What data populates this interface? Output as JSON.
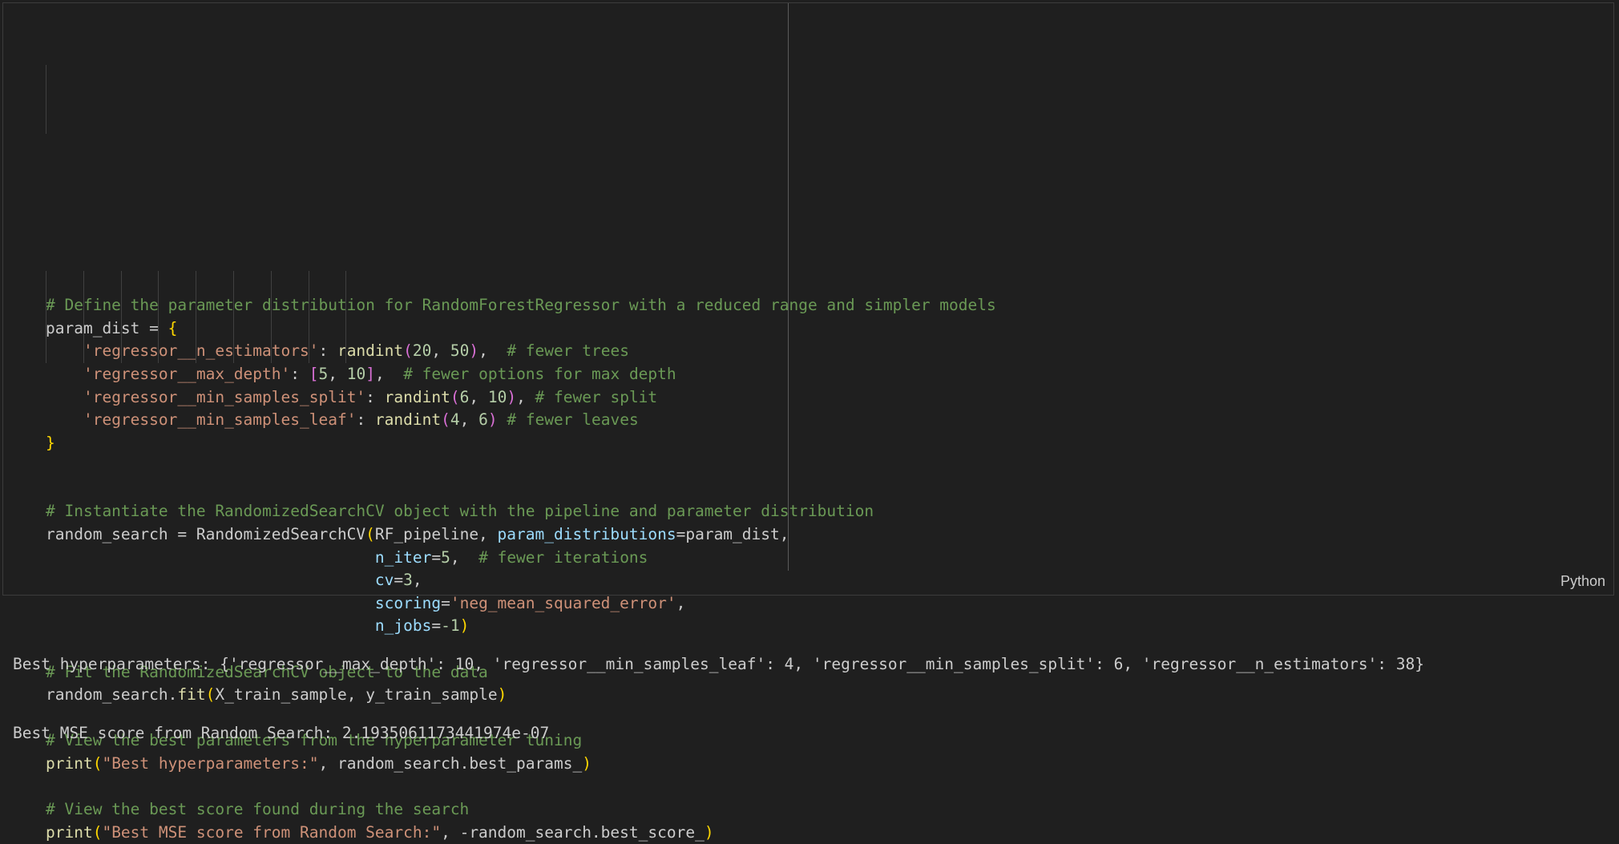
{
  "cell": {
    "language": "Python",
    "lines": [
      {
        "tokens": [
          {
            "t": "# Define the parameter distribution for RandomForestRegressor with a reduced range and simpler models",
            "c": "cmt"
          }
        ]
      },
      {
        "tokens": [
          {
            "t": "param_dist = ",
            "c": ""
          },
          {
            "t": "{",
            "c": "b1"
          }
        ]
      },
      {
        "tokens": [
          {
            "t": "    ",
            "c": ""
          },
          {
            "t": "'regressor__n_estimators'",
            "c": "str"
          },
          {
            "t": ": ",
            "c": ""
          },
          {
            "t": "randint",
            "c": "fn"
          },
          {
            "t": "(",
            "c": "b2"
          },
          {
            "t": "20",
            "c": "num"
          },
          {
            "t": ", ",
            "c": ""
          },
          {
            "t": "50",
            "c": "num"
          },
          {
            "t": ")",
            "c": "b2"
          },
          {
            "t": ",  ",
            "c": ""
          },
          {
            "t": "# fewer trees",
            "c": "cmt"
          }
        ]
      },
      {
        "tokens": [
          {
            "t": "    ",
            "c": ""
          },
          {
            "t": "'regressor__max_depth'",
            "c": "str"
          },
          {
            "t": ": ",
            "c": ""
          },
          {
            "t": "[",
            "c": "b2"
          },
          {
            "t": "5",
            "c": "num"
          },
          {
            "t": ", ",
            "c": ""
          },
          {
            "t": "10",
            "c": "num"
          },
          {
            "t": "]",
            "c": "b2"
          },
          {
            "t": ",  ",
            "c": ""
          },
          {
            "t": "# fewer options for max depth",
            "c": "cmt"
          }
        ]
      },
      {
        "tokens": [
          {
            "t": "    ",
            "c": ""
          },
          {
            "t": "'regressor__min_samples_split'",
            "c": "str"
          },
          {
            "t": ": ",
            "c": ""
          },
          {
            "t": "randint",
            "c": "fn"
          },
          {
            "t": "(",
            "c": "b2"
          },
          {
            "t": "6",
            "c": "num"
          },
          {
            "t": ", ",
            "c": ""
          },
          {
            "t": "10",
            "c": "num"
          },
          {
            "t": ")",
            "c": "b2"
          },
          {
            "t": ", ",
            "c": ""
          },
          {
            "t": "# fewer split",
            "c": "cmt"
          }
        ]
      },
      {
        "tokens": [
          {
            "t": "    ",
            "c": ""
          },
          {
            "t": "'regressor__min_samples_leaf'",
            "c": "str"
          },
          {
            "t": ": ",
            "c": ""
          },
          {
            "t": "randint",
            "c": "fn"
          },
          {
            "t": "(",
            "c": "b2"
          },
          {
            "t": "4",
            "c": "num"
          },
          {
            "t": ", ",
            "c": ""
          },
          {
            "t": "6",
            "c": "num"
          },
          {
            "t": ")",
            "c": "b2"
          },
          {
            "t": " ",
            "c": ""
          },
          {
            "t": "# fewer leaves",
            "c": "cmt"
          }
        ]
      },
      {
        "tokens": [
          {
            "t": "}",
            "c": "b1"
          }
        ]
      },
      {
        "tokens": []
      },
      {
        "tokens": []
      },
      {
        "tokens": [
          {
            "t": "# Instantiate the RandomizedSearchCV object with the pipeline and parameter distribution",
            "c": "cmt"
          }
        ]
      },
      {
        "tokens": [
          {
            "t": "random_search = ",
            "c": ""
          },
          {
            "t": "RandomizedSearchCV",
            "c": ""
          },
          {
            "t": "(",
            "c": "b1"
          },
          {
            "t": "RF_pipeline, ",
            "c": ""
          },
          {
            "t": "param_distributions",
            "c": "param"
          },
          {
            "t": "=param_dist,",
            "c": ""
          }
        ]
      },
      {
        "tokens": [
          {
            "t": "                                   ",
            "c": ""
          },
          {
            "t": "n_iter",
            "c": "param"
          },
          {
            "t": "=",
            "c": ""
          },
          {
            "t": "5",
            "c": "num"
          },
          {
            "t": ",  ",
            "c": ""
          },
          {
            "t": "# fewer iterations",
            "c": "cmt"
          }
        ]
      },
      {
        "tokens": [
          {
            "t": "                                   ",
            "c": ""
          },
          {
            "t": "cv",
            "c": "param"
          },
          {
            "t": "=",
            "c": ""
          },
          {
            "t": "3",
            "c": "num"
          },
          {
            "t": ",",
            "c": ""
          }
        ]
      },
      {
        "tokens": [
          {
            "t": "                                   ",
            "c": ""
          },
          {
            "t": "scoring",
            "c": "param"
          },
          {
            "t": "=",
            "c": ""
          },
          {
            "t": "'neg_mean_squared_error'",
            "c": "str"
          },
          {
            "t": ",",
            "c": ""
          }
        ]
      },
      {
        "tokens": [
          {
            "t": "                                   ",
            "c": ""
          },
          {
            "t": "n_jobs",
            "c": "param"
          },
          {
            "t": "=",
            "c": ""
          },
          {
            "t": "-1",
            "c": "num"
          },
          {
            "t": ")",
            "c": "b1"
          }
        ]
      },
      {
        "tokens": []
      },
      {
        "tokens": [
          {
            "t": "# Fit the RandomizedSearchCV object to the data",
            "c": "cmt"
          }
        ]
      },
      {
        "tokens": [
          {
            "t": "random_search.",
            "c": ""
          },
          {
            "t": "fit",
            "c": "fn"
          },
          {
            "t": "(",
            "c": "b1"
          },
          {
            "t": "X_train_sample, y_train_sample",
            "c": ""
          },
          {
            "t": ")",
            "c": "b1"
          }
        ]
      },
      {
        "tokens": []
      },
      {
        "tokens": [
          {
            "t": "# View the best parameters from the hyperparameter tuning",
            "c": "cmt"
          }
        ]
      },
      {
        "tokens": [
          {
            "t": "print",
            "c": "fn"
          },
          {
            "t": "(",
            "c": "b1"
          },
          {
            "t": "\"Best hyperparameters:\"",
            "c": "str"
          },
          {
            "t": ", random_search.best_params_",
            "c": ""
          },
          {
            "t": ")",
            "c": "b1"
          }
        ]
      },
      {
        "tokens": []
      },
      {
        "tokens": [
          {
            "t": "# View the best score found during the search",
            "c": "cmt"
          }
        ]
      },
      {
        "tokens": [
          {
            "t": "print",
            "c": "fn"
          },
          {
            "t": "(",
            "c": "b1"
          },
          {
            "t": "\"Best MSE score from Random Search:\"",
            "c": "str"
          },
          {
            "t": ", -random_search.best_score_",
            "c": ""
          },
          {
            "t": ")",
            "c": "b1"
          }
        ]
      }
    ]
  },
  "output": {
    "lines": [
      "Best hyperparameters: {'regressor__max_depth': 10, 'regressor__min_samples_leaf': 4, 'regressor__min_samples_split': 6, 'regressor__n_estimators': 38}",
      "Best MSE score from Random Search: 2.1935061173441974e-07"
    ]
  }
}
